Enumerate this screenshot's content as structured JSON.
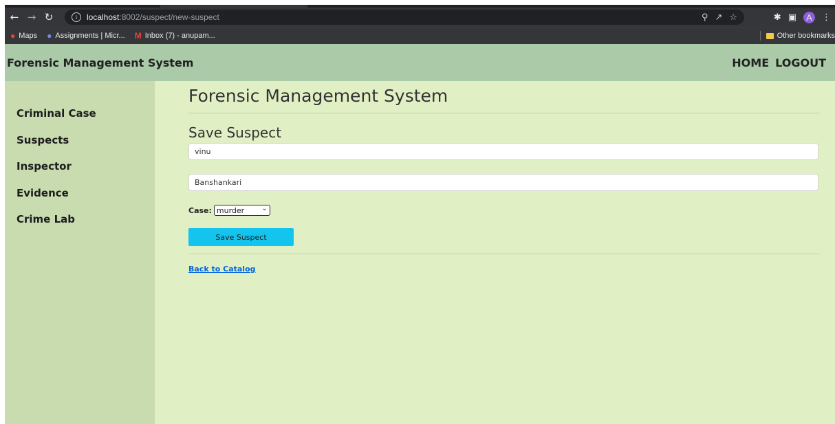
{
  "browser": {
    "url_host": "localhost",
    "url_path": ":8002/suspect/new-suspect",
    "bookmarks": [
      {
        "label": "Maps"
      },
      {
        "label": "Assignments | Micr..."
      },
      {
        "label": "Inbox (7) - anupam..."
      }
    ],
    "other_bookmarks": "Other bookmarks",
    "avatar_letter": "A"
  },
  "header": {
    "brand": "Forensic Management System",
    "nav": [
      "HOME",
      "LOGOUT"
    ]
  },
  "sidebar": {
    "items": [
      "Criminal Case",
      "Suspects",
      "Inspector",
      "Evidence",
      "Crime Lab"
    ]
  },
  "main": {
    "title": "Forensic Management System",
    "subtitle": "Save Suspect",
    "name_value": "vinu",
    "address_value": "Banshankari",
    "case_label": "Case:",
    "case_selected": "murder",
    "save_button": "Save Suspect",
    "back_link": "Back to Catalog"
  },
  "colors": {
    "header_bg": "#aacaa8",
    "sidebar_bg": "#c9dcb0",
    "page_bg": "#e1f0c4",
    "button_bg": "#13c4ee"
  }
}
